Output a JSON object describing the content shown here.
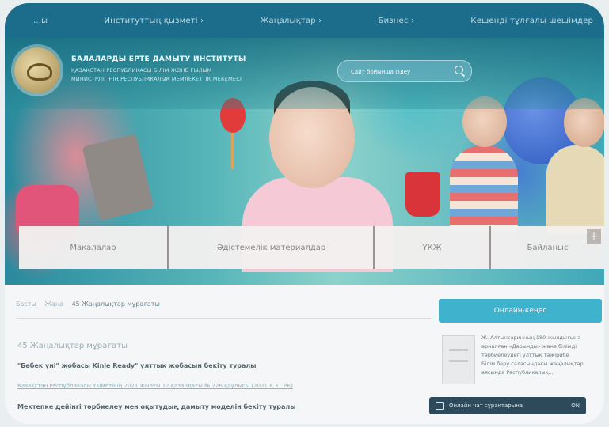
{
  "nav": {
    "items": [
      "...ы",
      "Институттың қызметі ›",
      "Жаңалықтар ›",
      "Бизнес ›",
      "Кешенді тұлғалы шешімдер"
    ]
  },
  "header": {
    "org_name": "БАЛАЛАРДЫ ЕРТЕ ДАМЫТУ ИНСТИТУТЫ",
    "org_sub_1": "ҚАЗАҚСТАН РЕСПУБЛИКАСЫ БІЛІМ ЖӘНЕ ҒЫЛЫМ",
    "org_sub_2": "МИНИСТРЛІГІНІҢ РЕСПУБЛИКАЛЫҚ МЕМЛЕКЕТТІК МЕКЕМЕСІ",
    "search_placeholder": "Сайт бойынша іздеу"
  },
  "cards": [
    {
      "label": "Мақалалар"
    },
    {
      "label": "Әдістемелік материалдар"
    },
    {
      "label": "ҮКЖ"
    },
    {
      "label": "Байланыс"
    }
  ],
  "breadcrumb": [
    "Басты",
    "Жаңа",
    "45 Жаңалықтар мұрағаты"
  ],
  "content": {
    "section_title": "45 Жаңалықтар мұрағаты",
    "article_1_title": "\"Бөбек үні\" жобасы Kinle Ready\" үлттық жобасын бекіту туралы",
    "article_1_meta": "Қазақстан Республикасы Үкіметінің 2021 жылғы 12 қазандағы № 726 қаулысы (2021.8.31.РК)",
    "article_2_title": "Мектепке дейінгі тәрбиелеу мен оқытудың дамыту моделін бекіту туралы"
  },
  "sidebar": {
    "cta_label": "Онлайн-кеңес",
    "news_lines": [
      "Ж. Алтынсаринның 180 жылдығына",
      "арналған «Дарынды» және білімді",
      "тәрбиелеудегі ұлттық тәжірибе",
      "Білім беру саласындағы жаңалықтар",
      "аясында Республикалық..."
    ]
  },
  "chat": {
    "label": "Онлайн чат сұрақтарына",
    "toggle": "ON"
  },
  "colors": {
    "nav_bg": "#1c6c8b",
    "cta": "#3fb3ce",
    "chat_bg": "#2c4a5c"
  }
}
